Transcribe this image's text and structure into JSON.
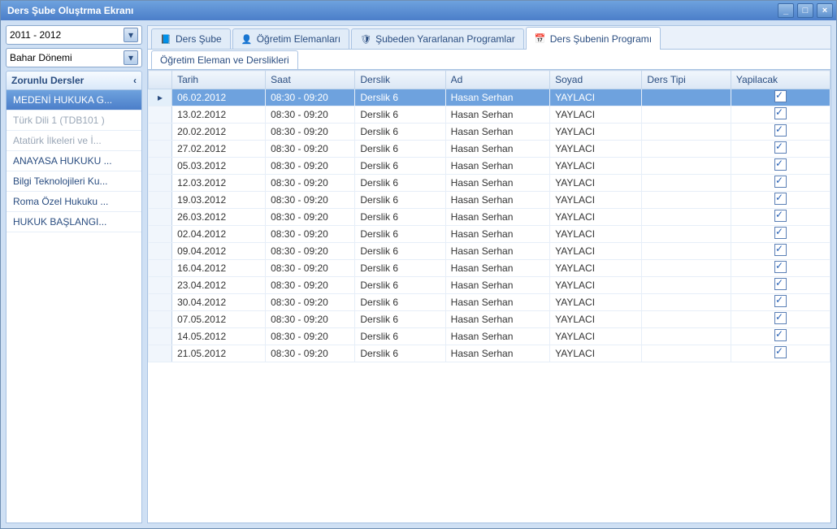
{
  "window": {
    "title": "Ders Şube Oluştrma Ekranı"
  },
  "left": {
    "year": "2011 - 2012",
    "term": "Bahar Dönemi",
    "panel_title": "Zorunlu Dersler",
    "items": [
      {
        "label": "MEDENİ HUKUKA G...",
        "selected": true,
        "dim": false
      },
      {
        "label": "Türk Dili 1 (TDB101  )",
        "selected": false,
        "dim": true
      },
      {
        "label": "Atatürk İlkeleri ve İ...",
        "selected": false,
        "dim": true
      },
      {
        "label": "ANAYASA HUKUKU ...",
        "selected": false,
        "dim": false
      },
      {
        "label": "Bilgi Teknolojileri Ku...",
        "selected": false,
        "dim": false
      },
      {
        "label": "Roma Özel Hukuku ...",
        "selected": false,
        "dim": false
      },
      {
        "label": "HUKUK  BAŞLANGI...",
        "selected": false,
        "dim": false
      }
    ]
  },
  "tabs": [
    {
      "label": "Ders Şube",
      "icon": "📘"
    },
    {
      "label": "Öğretim Elemanları",
      "icon": "👤"
    },
    {
      "label": "Şubeden Yararlanan  Programlar",
      "icon": "🛡"
    },
    {
      "label": "Ders Şubenin Programı",
      "icon": "📅",
      "active": true
    }
  ],
  "subtab": "Öğretim Eleman ve Derslikleri",
  "columns": [
    "Tarih",
    "Saat",
    "Derslik",
    "Ad",
    "Soyad",
    "Ders Tipi",
    "Yapilacak"
  ],
  "rows": [
    {
      "tarih": "06.02.2012",
      "saat": "08:30 - 09:20",
      "derslik": "Derslik 6",
      "ad": "Hasan Serhan",
      "soyad": "YAYLACI",
      "tipi": "",
      "yap": true,
      "sel": true
    },
    {
      "tarih": "13.02.2012",
      "saat": "08:30 - 09:20",
      "derslik": "Derslik 6",
      "ad": "Hasan Serhan",
      "soyad": "YAYLACI",
      "tipi": "",
      "yap": true
    },
    {
      "tarih": "20.02.2012",
      "saat": "08:30 - 09:20",
      "derslik": "Derslik 6",
      "ad": "Hasan Serhan",
      "soyad": "YAYLACI",
      "tipi": "",
      "yap": true
    },
    {
      "tarih": "27.02.2012",
      "saat": "08:30 - 09:20",
      "derslik": "Derslik 6",
      "ad": "Hasan Serhan",
      "soyad": "YAYLACI",
      "tipi": "",
      "yap": true
    },
    {
      "tarih": "05.03.2012",
      "saat": "08:30 - 09:20",
      "derslik": "Derslik 6",
      "ad": "Hasan Serhan",
      "soyad": "YAYLACI",
      "tipi": "",
      "yap": true
    },
    {
      "tarih": "12.03.2012",
      "saat": "08:30 - 09:20",
      "derslik": "Derslik 6",
      "ad": "Hasan Serhan",
      "soyad": "YAYLACI",
      "tipi": "",
      "yap": true
    },
    {
      "tarih": "19.03.2012",
      "saat": "08:30 - 09:20",
      "derslik": "Derslik 6",
      "ad": "Hasan Serhan",
      "soyad": "YAYLACI",
      "tipi": "",
      "yap": true
    },
    {
      "tarih": "26.03.2012",
      "saat": "08:30 - 09:20",
      "derslik": "Derslik 6",
      "ad": "Hasan Serhan",
      "soyad": "YAYLACI",
      "tipi": "",
      "yap": true
    },
    {
      "tarih": "02.04.2012",
      "saat": "08:30 - 09:20",
      "derslik": "Derslik 6",
      "ad": "Hasan Serhan",
      "soyad": "YAYLACI",
      "tipi": "",
      "yap": true
    },
    {
      "tarih": "09.04.2012",
      "saat": "08:30 - 09:20",
      "derslik": "Derslik 6",
      "ad": "Hasan Serhan",
      "soyad": "YAYLACI",
      "tipi": "",
      "yap": true
    },
    {
      "tarih": "16.04.2012",
      "saat": "08:30 - 09:20",
      "derslik": "Derslik 6",
      "ad": "Hasan Serhan",
      "soyad": "YAYLACI",
      "tipi": "",
      "yap": true
    },
    {
      "tarih": "23.04.2012",
      "saat": "08:30 - 09:20",
      "derslik": "Derslik 6",
      "ad": "Hasan Serhan",
      "soyad": "YAYLACI",
      "tipi": "",
      "yap": true
    },
    {
      "tarih": "30.04.2012",
      "saat": "08:30 - 09:20",
      "derslik": "Derslik 6",
      "ad": "Hasan Serhan",
      "soyad": "YAYLACI",
      "tipi": "",
      "yap": true
    },
    {
      "tarih": "07.05.2012",
      "saat": "08:30 - 09:20",
      "derslik": "Derslik 6",
      "ad": "Hasan Serhan",
      "soyad": "YAYLACI",
      "tipi": "",
      "yap": true
    },
    {
      "tarih": "14.05.2012",
      "saat": "08:30 - 09:20",
      "derslik": "Derslik 6",
      "ad": "Hasan Serhan",
      "soyad": "YAYLACI",
      "tipi": "",
      "yap": true
    },
    {
      "tarih": "21.05.2012",
      "saat": "08:30 - 09:20",
      "derslik": "Derslik 6",
      "ad": "Hasan Serhan",
      "soyad": "YAYLACI",
      "tipi": "",
      "yap": true
    }
  ]
}
